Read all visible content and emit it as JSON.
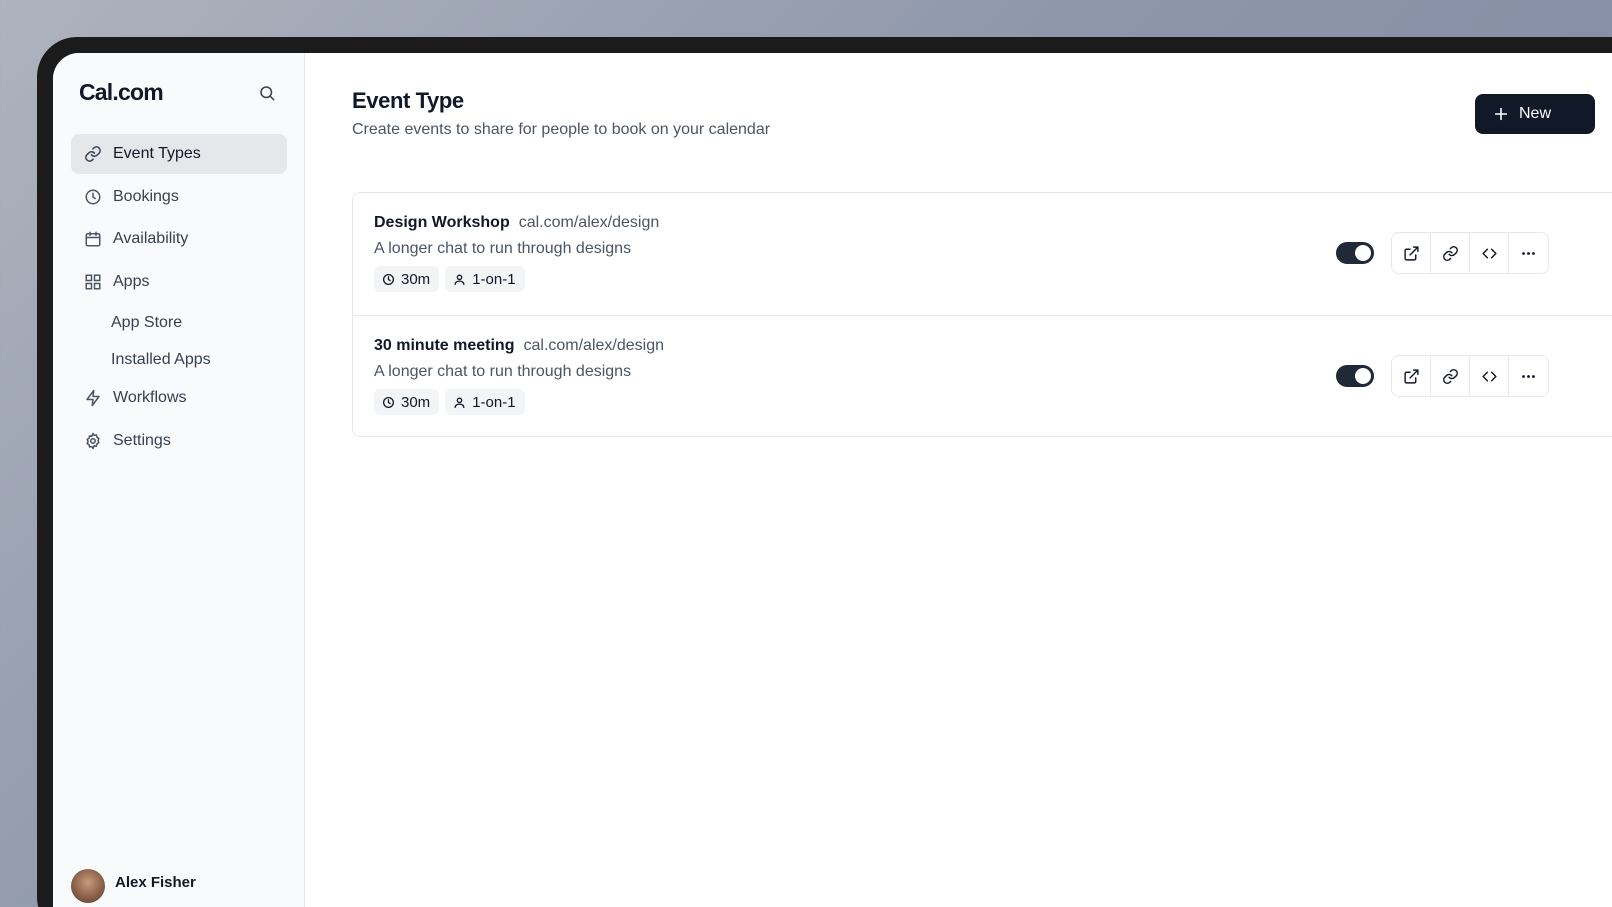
{
  "app": {
    "logo": "Cal.com"
  },
  "sidebar": {
    "items": [
      {
        "label": "Event Types",
        "icon": "link-icon",
        "active": true
      },
      {
        "label": "Bookings",
        "icon": "clock-icon"
      },
      {
        "label": "Availability",
        "icon": "calendar-icon"
      },
      {
        "label": "Apps",
        "icon": "grid-icon"
      },
      {
        "label": "Workflows",
        "icon": "bolt-icon"
      },
      {
        "label": "Settings",
        "icon": "gear-icon"
      }
    ],
    "apps_sub": [
      "App Store",
      "Installed Apps"
    ],
    "user": {
      "name": "Alex Fisher"
    }
  },
  "main": {
    "title": "Event Type",
    "subtitle": "Create events to share for people to book on your calendar",
    "new_label": "New",
    "events": [
      {
        "title": "Design Workshop",
        "slug": "cal.com/alex/design",
        "description": "A longer chat to run through designs",
        "duration": "30m",
        "type": "1-on-1",
        "enabled": true
      },
      {
        "title": "30 minute meeting",
        "slug": "cal.com/alex/design",
        "description": "A longer chat to run through designs",
        "duration": "30m",
        "type": "1-on-1",
        "enabled": true
      }
    ]
  },
  "colors": {
    "primary": "#111827",
    "sidebar_bg": "#f9fafb",
    "border": "#e5e7eb"
  }
}
